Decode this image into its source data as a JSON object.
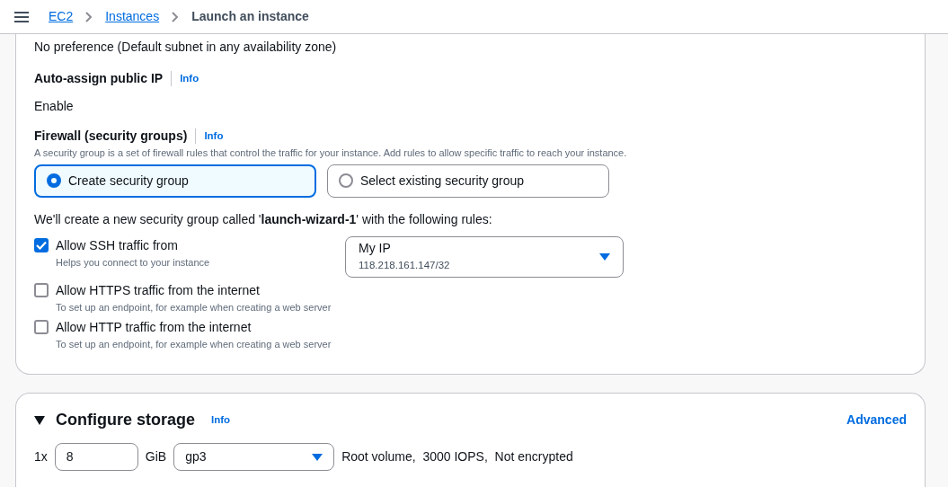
{
  "breadcrumb": [
    {
      "label": "EC2",
      "link": true
    },
    {
      "label": "Instances",
      "link": true
    },
    {
      "label": "Launch an instance",
      "link": false
    }
  ],
  "network": {
    "subnet_value": "No preference (Default subnet in any availability zone)",
    "auto_assign": {
      "label": "Auto-assign public IP",
      "info": "Info",
      "value": "Enable"
    },
    "firewall": {
      "label": "Firewall (security groups)",
      "info": "Info",
      "description": "A security group is a set of firewall rules that control the traffic for your instance. Add rules to allow specific traffic to reach your instance.",
      "options": [
        {
          "label": "Create security group",
          "selected": true
        },
        {
          "label": "Select existing security group",
          "selected": false
        }
      ],
      "note": "We'll create a new security group called '**launch-wizard-1**' with the following rules:",
      "rules": [
        {
          "label": "Allow SSH traffic from",
          "hint": "Helps you connect to your instance",
          "checked": true
        },
        {
          "label": "Allow HTTPS traffic from the internet",
          "hint": "To set up an endpoint, for example when creating a web server",
          "checked": false
        },
        {
          "label": "Allow HTTP traffic from the internet",
          "hint": "To set up an endpoint, for example when creating a web server",
          "checked": false
        }
      ],
      "ssh_source": {
        "value": "My IP",
        "detail": "118.218.161.147/32"
      }
    }
  },
  "storage": {
    "title": "Configure storage",
    "expanded": true,
    "info": "Info",
    "advanced": "Advanced",
    "quantity": "1x",
    "size": "8",
    "unit": "GiB",
    "volume_type": "gp3",
    "summary": "Root volume,  3000 IOPS,  Not encrypted"
  }
}
